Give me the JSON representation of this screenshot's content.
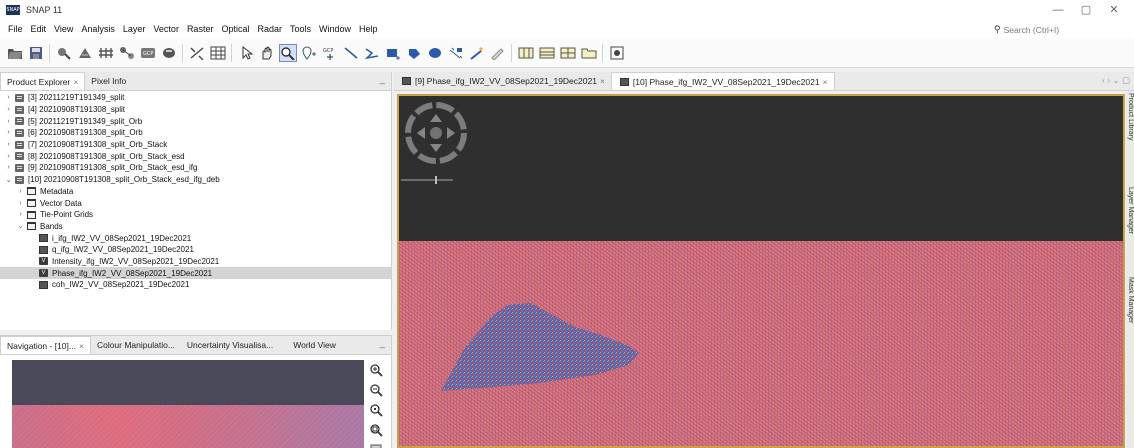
{
  "window": {
    "title": "SNAP 11",
    "logo_text": "SNAP",
    "controls": [
      "—",
      "▢",
      "✕"
    ]
  },
  "menu": [
    "File",
    "Edit",
    "View",
    "Analysis",
    "Layer",
    "Vector",
    "Raster",
    "Optical",
    "Radar",
    "Tools",
    "Window",
    "Help"
  ],
  "search": {
    "placeholder": "Search (Ctrl+I)",
    "icon": "search-icon"
  },
  "toolbar": {
    "icons": [
      "open-product-icon",
      "save-product-icon",
      "band-maths-icon",
      "filtered-band-icon",
      "mask-manager-icon",
      "graph-icon",
      "gcp-manager-icon",
      "pin-manager-icon",
      "range-finder-icon",
      "grid-icon",
      "select-tool-icon",
      "pan-tool-icon",
      "zoom-tool-icon",
      "pin-placing-icon",
      "gcp-placing-icon",
      "line-drawing-icon",
      "polyline-drawing-icon",
      "rectangle-drawing-icon",
      "polygon-drawing-icon",
      "ellipse-drawing-icon",
      "range-finder-tool-icon",
      "magic-wand-icon",
      "tile-evenly-icon",
      "tile-horizontally-icon",
      "tile-vertically-icon",
      "tile-single-icon",
      "sync-views-icon"
    ]
  },
  "product_explorer": {
    "tabs": [
      {
        "label": "Product Explorer",
        "close": "×",
        "active": true
      },
      {
        "label": "Pixel Info",
        "close": "",
        "active": false
      }
    ],
    "minimize": "_",
    "tree": [
      {
        "label": "[3] 20211219T191349_split",
        "indent": 0,
        "arrow": "›",
        "icon": "product"
      },
      {
        "label": "[4] 20210908T191308_split",
        "indent": 0,
        "arrow": "›",
        "icon": "product"
      },
      {
        "label": "[5] 20211219T191349_split_Orb",
        "indent": 0,
        "arrow": "›",
        "icon": "product"
      },
      {
        "label": "[6] 20210908T191308_split_Orb",
        "indent": 0,
        "arrow": "›",
        "icon": "product"
      },
      {
        "label": "[7] 20210908T191308_split_Orb_Stack",
        "indent": 0,
        "arrow": "›",
        "icon": "product"
      },
      {
        "label": "[8] 20210908T191308_split_Orb_Stack_esd",
        "indent": 0,
        "arrow": "›",
        "icon": "product"
      },
      {
        "label": "[9] 20210908T191308_split_Orb_Stack_esd_ifg",
        "indent": 0,
        "arrow": "›",
        "icon": "product"
      },
      {
        "label": "[10] 20210908T191308_split_Orb_Stack_esd_ifg_deb",
        "indent": 0,
        "arrow": "⌄",
        "icon": "product"
      },
      {
        "label": "Metadata",
        "indent": 1,
        "arrow": "›",
        "icon": "folder"
      },
      {
        "label": "Vector Data",
        "indent": 1,
        "arrow": "›",
        "icon": "folder"
      },
      {
        "label": "Tie-Point Grids",
        "indent": 1,
        "arrow": "›",
        "icon": "folder"
      },
      {
        "label": "Bands",
        "indent": 1,
        "arrow": "⌄",
        "icon": "folder"
      },
      {
        "label": "i_ifg_IW2_VV_08Sep2021_19Dec2021",
        "indent": 2,
        "arrow": "",
        "icon": "band"
      },
      {
        "label": "q_ifg_IW2_VV_08Sep2021_19Dec2021",
        "indent": 2,
        "arrow": "",
        "icon": "band"
      },
      {
        "label": "Intensity_ifg_IW2_VV_08Sep2021_19Dec2021",
        "indent": 2,
        "arrow": "",
        "icon": "virtual"
      },
      {
        "label": "Phase_ifg_IW2_VV_08Sep2021_19Dec2021",
        "indent": 2,
        "arrow": "",
        "icon": "virtual",
        "selected": true
      },
      {
        "label": "coh_IW2_VV_08Sep2021_19Dec2021",
        "indent": 2,
        "arrow": "",
        "icon": "band"
      }
    ],
    "virtual_badge": "V"
  },
  "navigation_panel": {
    "tabs": [
      {
        "label": "Navigation - [10]...",
        "close": "×",
        "active": true
      },
      {
        "label": "Colour Manipulatio...",
        "close": "",
        "active": false
      },
      {
        "label": "Uncertainty Visualisa...",
        "close": "",
        "active": false
      },
      {
        "label": "World View",
        "close": "",
        "active": false
      }
    ],
    "minimize": "_",
    "zoom_buttons": [
      "zoom-in-icon",
      "zoom-out-icon",
      "zoom-pixel-icon",
      "zoom-all-icon",
      "sync-icon"
    ]
  },
  "image_views": {
    "tabs": [
      {
        "label": "[9] Phase_ifg_IW2_VV_08Sep2021_19Dec2021",
        "close": "×",
        "active": false
      },
      {
        "label": "[10] Phase_ifg_IW2_VV_08Sep2021_19Dec2021",
        "close": "×",
        "active": true
      }
    ],
    "controls": "‹ › ⌄ ▢"
  },
  "right_rail": [
    "Product Library",
    "Layer Manager",
    "Mask Manager"
  ],
  "colors": {
    "view_border": "#c8a24a",
    "phase_base": "#e07e66",
    "phase_purple": "#7850be",
    "dark_area": "#2f2f2f",
    "selection": "#d4d4d4"
  }
}
